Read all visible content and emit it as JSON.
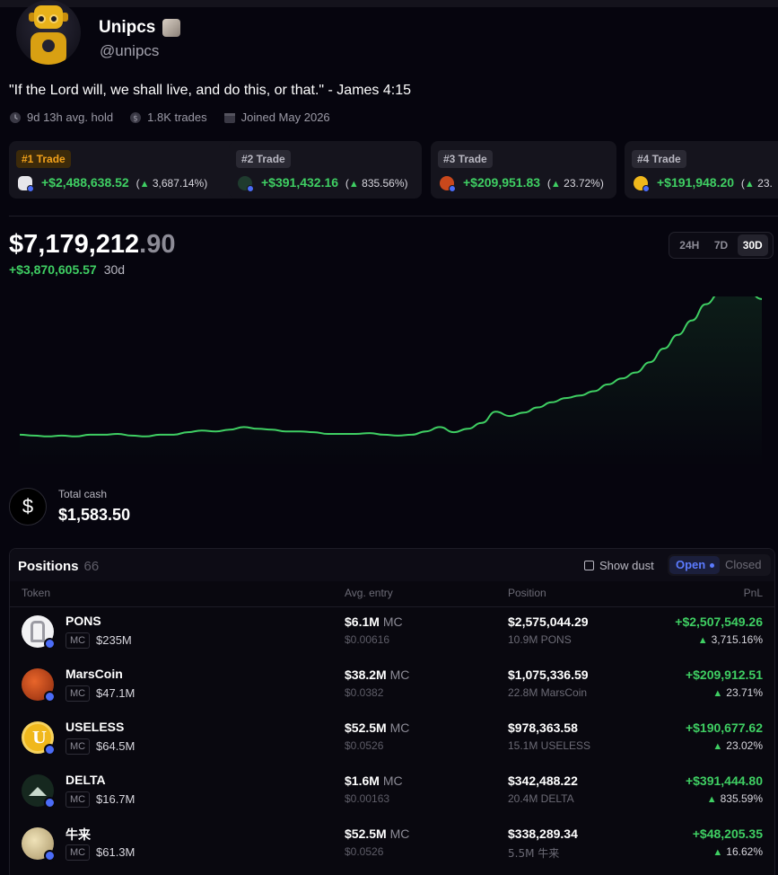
{
  "profile": {
    "name": "Unipcs",
    "handle": "@unipcs",
    "bio": "\"If the Lord will, we shall live, and do this, or that.\" - James 4:15",
    "stats": {
      "avg_hold": "9d 13h avg. hold",
      "trades": "1.8K trades",
      "joined": "Joined May 2026"
    }
  },
  "top_trades": [
    {
      "tag": "#1 Trade",
      "pnl": "+$2,488,638.52",
      "pct": "3,687.14%",
      "coin_color": "#e6e6ea"
    },
    {
      "tag": "#2 Trade",
      "pnl": "+$391,432.16",
      "pct": "835.56%",
      "coin_color": "#1f3b2e"
    },
    {
      "tag": "#3 Trade",
      "pnl": "+$209,951.83",
      "pct": "23.72%",
      "coin_color": "#c9481c"
    },
    {
      "tag": "#4 Trade",
      "pnl": "+$191,948.20",
      "pct": "23.",
      "coin_color": "#f0b81c"
    }
  ],
  "portfolio": {
    "value_main": "$7,179,212",
    "value_cents": ".90",
    "change": "+$3,870,605.57",
    "change_period": "30d",
    "ranges": [
      "24H",
      "7D",
      "30D"
    ],
    "active_range": "30D"
  },
  "chart_data": {
    "type": "area",
    "series": [
      {
        "values": [
          0.19,
          0.18,
          0.17,
          0.18,
          0.17,
          0.19,
          0.19,
          0.2,
          0.18,
          0.17,
          0.19,
          0.19,
          0.22,
          0.24,
          0.23,
          0.25,
          0.28,
          0.26,
          0.25,
          0.23,
          0.23,
          0.22,
          0.2,
          0.2,
          0.2,
          0.21,
          0.19,
          0.18,
          0.19,
          0.23,
          0.28,
          0.22,
          0.26,
          0.33,
          0.46,
          0.41,
          0.45,
          0.51,
          0.57,
          0.62,
          0.65,
          0.7,
          0.78,
          0.85,
          0.92,
          1.04,
          1.2,
          1.36,
          1.53,
          1.72,
          1.85,
          1.89,
          1.87,
          1.78
        ]
      }
    ],
    "color": "#3fcf63"
  },
  "cash": {
    "label": "Total cash",
    "value": "$1,583.50"
  },
  "positions": {
    "title": "Positions",
    "count": "66",
    "show_dust": "Show dust",
    "open_label": "Open",
    "closed_label": "Closed",
    "columns": [
      "Token",
      "Avg. entry",
      "Position",
      "PnL"
    ],
    "rows": [
      {
        "name": "PONS",
        "mc": "MC",
        "mc_value": "$235M",
        "entry": "$6.1M",
        "entry_mc": "MC",
        "entry_price": "$0.00616",
        "position": "$2,575,044.29",
        "amount": "10.9M PONS",
        "pnl": "+$2,507,549.26",
        "pnl_pct": "3,715.16%",
        "color": "#f2f2f4"
      },
      {
        "name": "MarsCoin",
        "mc": "MC",
        "mc_value": "$47.1M",
        "entry": "$38.2M",
        "entry_mc": "MC",
        "entry_price": "$0.0382",
        "position": "$1,075,336.59",
        "amount": "22.8M MarsCoin",
        "pnl": "+$209,912.51",
        "pnl_pct": "23.71%",
        "color": "#c9481c"
      },
      {
        "name": "USELESS",
        "mc": "MC",
        "mc_value": "$64.5M",
        "entry": "$52.5M",
        "entry_mc": "MC",
        "entry_price": "$0.0526",
        "position": "$978,363.58",
        "amount": "15.1M USELESS",
        "pnl": "+$190,677.62",
        "pnl_pct": "23.02%",
        "color": "#f0b81c"
      },
      {
        "name": "DELTA",
        "mc": "MC",
        "mc_value": "$16.7M",
        "entry": "$1.6M",
        "entry_mc": "MC",
        "entry_price": "$0.00163",
        "position": "$342,488.22",
        "amount": "20.4M DELTA",
        "pnl": "+$391,444.80",
        "pnl_pct": "835.59%",
        "color": "#16281f"
      },
      {
        "name": "牛来",
        "mc": "MC",
        "mc_value": "$61.3M",
        "entry": "$52.5M",
        "entry_mc": "MC",
        "entry_price": "$0.0526",
        "position": "$338,289.34",
        "amount": "5.5M 牛来",
        "pnl": "+$48,205.35",
        "pnl_pct": "16.62%",
        "color": "#d6c69a"
      }
    ]
  }
}
